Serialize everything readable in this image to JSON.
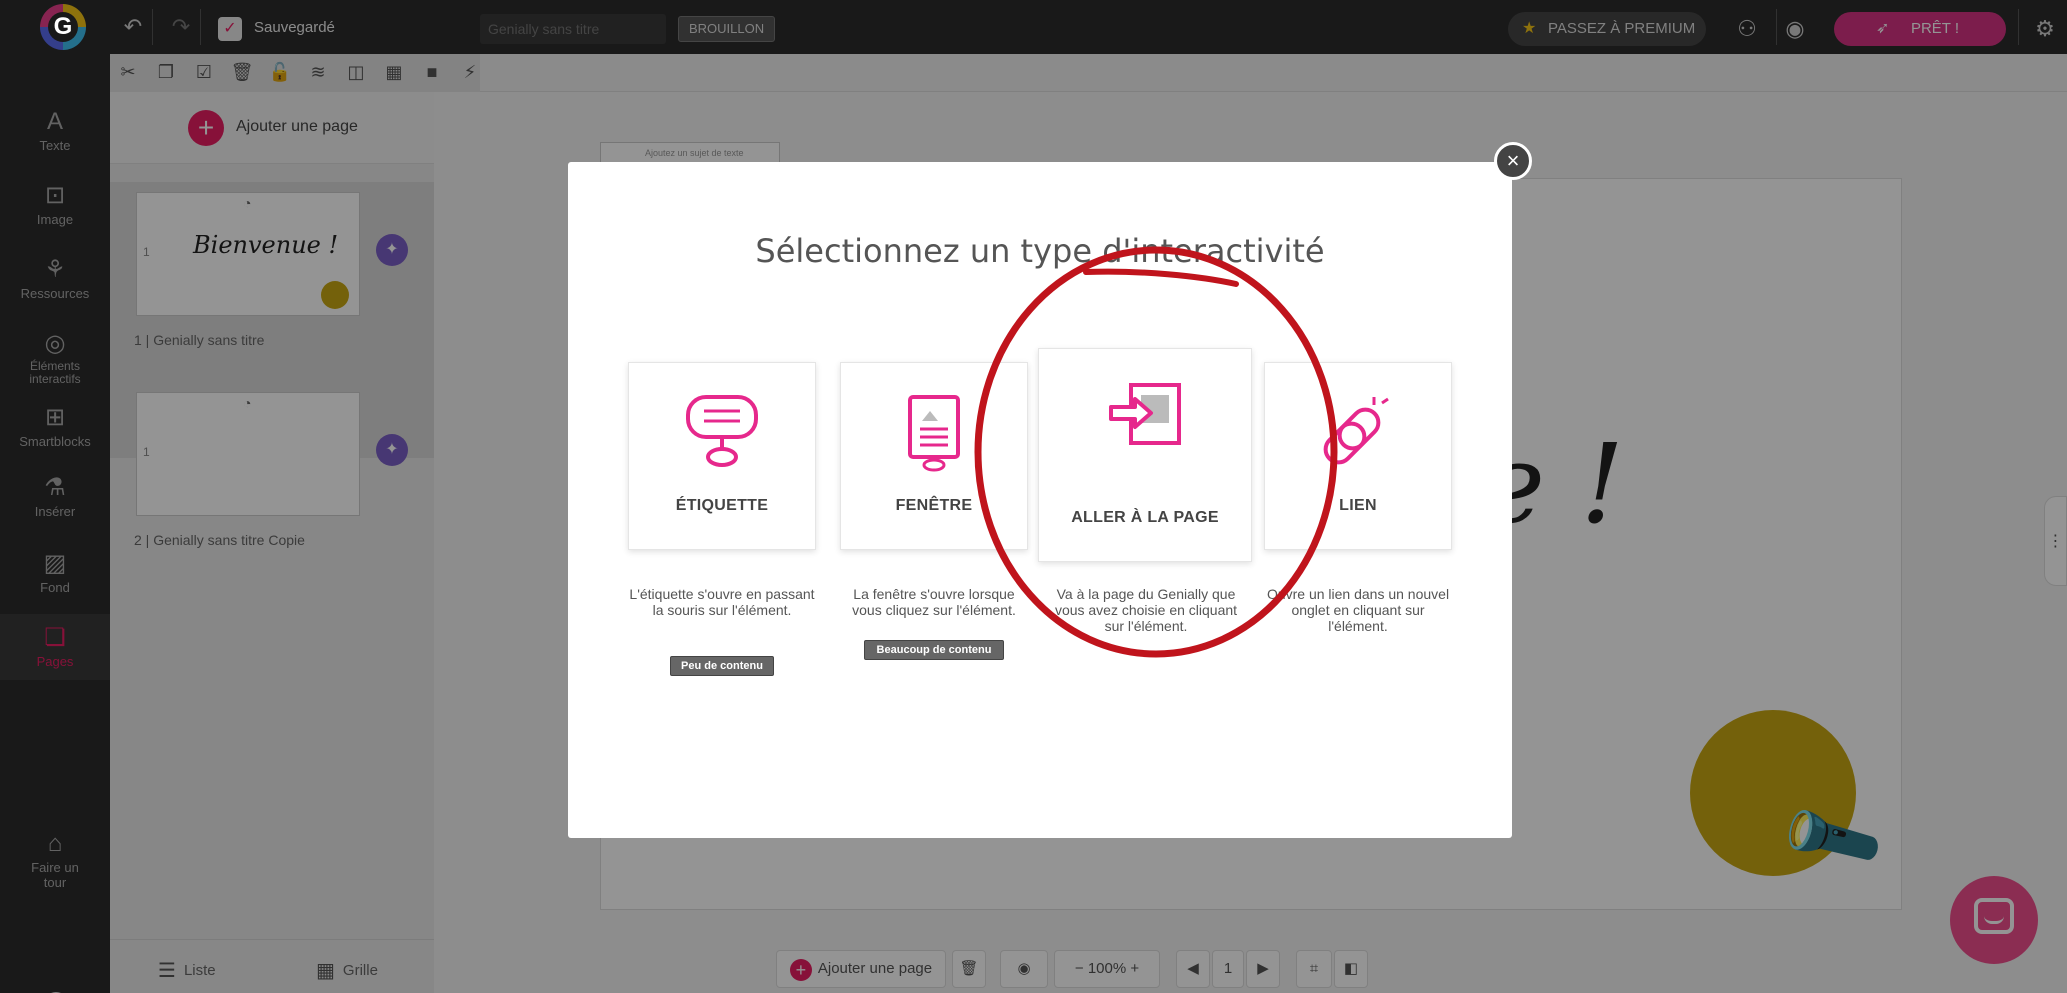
{
  "app": {
    "saved_label": "Sauvegardé",
    "title_placeholder": "Genially sans titre",
    "draft_badge": "BROUILLON",
    "premium_label": "PASSEZ À PREMIUM",
    "ready_label": "PRÊT !"
  },
  "sidebar": {
    "items": [
      {
        "label": "Texte",
        "icon": "text-icon"
      },
      {
        "label": "Image",
        "icon": "image-icon"
      },
      {
        "label": "Ressources",
        "icon": "resources-icon"
      },
      {
        "label": "Éléments interactifs",
        "icon": "interactive-icon"
      },
      {
        "label": "Smartblocks",
        "icon": "smartblocks-icon"
      },
      {
        "label": "Insérer",
        "icon": "insert-icon"
      },
      {
        "label": "Fond",
        "icon": "background-icon"
      },
      {
        "label": "Pages",
        "icon": "pages-icon"
      }
    ],
    "tour_label": "Faire un tour",
    "help_label": "?"
  },
  "pages_panel": {
    "add_page_label": "Ajouter une page",
    "pages": [
      {
        "name": "1 | Genially sans titre",
        "thumb_text": "Bienvenue !",
        "num": "1"
      },
      {
        "name": "2 | Genially sans titre Copie",
        "thumb_text": "",
        "num": "1"
      }
    ],
    "list_label": "Liste",
    "grid_label": "Grille"
  },
  "canvas": {
    "visible_text": "e !",
    "add_text_hint": "Ajoutez un sujet de texte"
  },
  "bottom_bar": {
    "add_page_label": "Ajouter une page",
    "zoom": "100%",
    "page_number": "1"
  },
  "modal": {
    "title": "Sélectionnez un type d'interactivité",
    "options": [
      {
        "label": "ÉTIQUETTE",
        "description": "L'étiquette s'ouvre en passant la souris sur l'élément.",
        "tag": "Peu de contenu",
        "icon": "label-icon"
      },
      {
        "label": "FENÊTRE",
        "description": "La fenêtre s'ouvre lorsque vous cliquez sur l'élément.",
        "tag": "Beaucoup de contenu",
        "icon": "window-icon"
      },
      {
        "label": "ALLER À LA PAGE",
        "description": "Va à la page du Genially que vous avez choisie en cliquant sur l'élément.",
        "tag": "",
        "icon": "go-to-page-icon"
      },
      {
        "label": "LIEN",
        "description": "Ouvre un lien dans un nouvel onglet en cliquant sur l'élément.",
        "tag": "",
        "icon": "link-icon"
      }
    ]
  },
  "colors": {
    "accent": "#e91e63",
    "icon_pink": "#e6288c",
    "annotation_red": "#c0141c",
    "dark_bar": "#2b2b2b"
  }
}
